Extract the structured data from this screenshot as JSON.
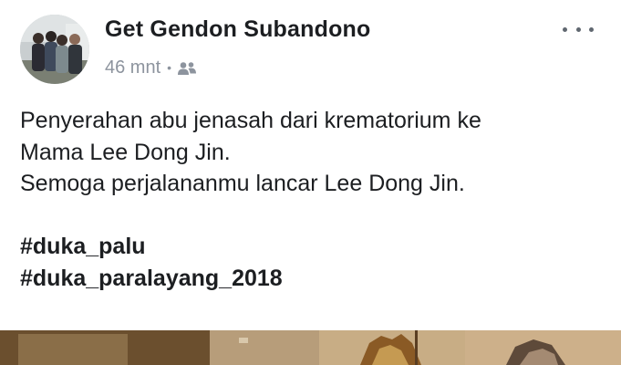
{
  "post": {
    "author": "Get Gendon Subandono",
    "time": "46 mnt",
    "separator": "•",
    "privacy_icon": "friends-icon",
    "more_icon": "more-dots-icon",
    "text_lines": [
      "Penyerahan abu jenasah dari krematorium ke",
      "Mama Lee Dong Jin.",
      "Semoga perjalananmu lancar Lee Dong Jin."
    ],
    "hashtags": [
      "#duka_palu",
      "#duka_paralayang_2018"
    ]
  },
  "colors": {
    "name": "#1c1e21",
    "meta": "#8d949e",
    "dots": "#606770"
  }
}
